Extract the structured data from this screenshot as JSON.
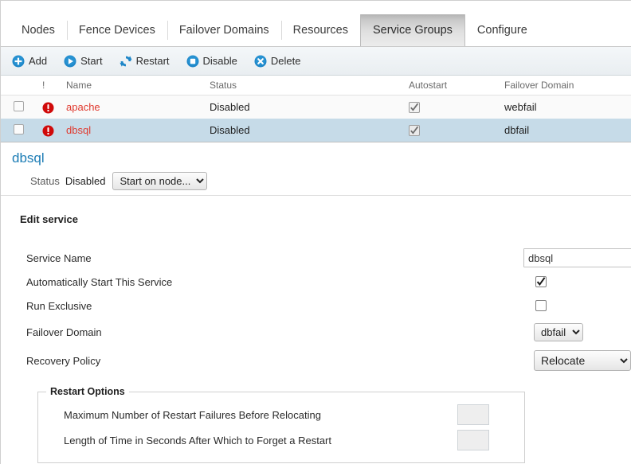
{
  "tabs": [
    {
      "label": "Nodes",
      "active": false
    },
    {
      "label": "Fence Devices",
      "active": false
    },
    {
      "label": "Failover Domains",
      "active": false
    },
    {
      "label": "Resources",
      "active": false
    },
    {
      "label": "Service Groups",
      "active": true
    },
    {
      "label": "Configure",
      "active": false
    }
  ],
  "toolbar": {
    "add_label": "Add",
    "start_label": "Start",
    "restart_label": "Restart",
    "disable_label": "Disable",
    "delete_label": "Delete",
    "icon_color": "#1f87c8"
  },
  "table": {
    "headers": {
      "bang": "!",
      "name": "Name",
      "status": "Status",
      "autostart": "Autostart",
      "failover_domain": "Failover Domain"
    },
    "rows": [
      {
        "name": "apache",
        "status": "Disabled",
        "autostart": "checked",
        "failover_domain": "webfail",
        "alert": "error-icon",
        "selected": false
      },
      {
        "name": "dbsql",
        "status": "Disabled",
        "autostart": "checked",
        "failover_domain": "dbfail",
        "alert": "error-icon",
        "selected": true
      }
    ],
    "link_color": "#e03a2f",
    "selected_row_color": "#c6dbe8"
  },
  "detail": {
    "title": "dbsql",
    "title_color": "#1b7cb5",
    "status_label": "Status",
    "status_value": "Disabled",
    "start_select_value": "Start on node...",
    "start_select_options": [
      "Start on node..."
    ]
  },
  "edit": {
    "heading": "Edit service",
    "service_name_label": "Service Name",
    "service_name_value": "dbsql",
    "autostart_label": "Automatically Start This Service",
    "autostart_checked": true,
    "exclusive_label": "Run Exclusive",
    "exclusive_checked": false,
    "failover_domain_label": "Failover Domain",
    "failover_domain_value": "dbfail",
    "failover_domain_options": [
      "dbfail"
    ],
    "recovery_policy_label": "Recovery Policy",
    "recovery_policy_value": "Relocate",
    "recovery_policy_options": [
      "Relocate"
    ]
  },
  "restart_options": {
    "legend": "Restart Options",
    "max_failures_label": "Maximum Number of Restart Failures Before Relocating",
    "max_failures_value": "",
    "forget_time_label": "Length of Time in Seconds After Which to Forget a Restart",
    "forget_time_value": ""
  }
}
